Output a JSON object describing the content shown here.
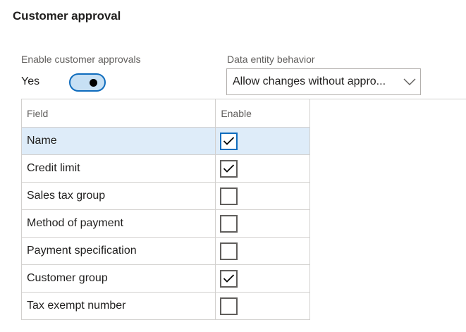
{
  "section": {
    "title": "Customer approval"
  },
  "enable_approvals": {
    "label": "Enable customer approvals",
    "value_text": "Yes",
    "on": true
  },
  "data_entity": {
    "label": "Data entity behavior",
    "selected": "Allow changes without appro..."
  },
  "grid": {
    "headers": {
      "field": "Field",
      "enable": "Enable"
    },
    "rows": [
      {
        "field": "Name",
        "enabled": true,
        "selected": true
      },
      {
        "field": "Credit limit",
        "enabled": true,
        "selected": false
      },
      {
        "field": "Sales tax group",
        "enabled": false,
        "selected": false
      },
      {
        "field": "Method of payment",
        "enabled": false,
        "selected": false
      },
      {
        "field": "Payment specification",
        "enabled": false,
        "selected": false
      },
      {
        "field": "Customer group",
        "enabled": true,
        "selected": false
      },
      {
        "field": "Tax exempt number",
        "enabled": false,
        "selected": false
      }
    ]
  },
  "colors": {
    "accent": "#0f6cbd",
    "selected_row": "#deecf9",
    "toggle_track": "#c7e0f4"
  },
  "icons": {
    "dropdown": "chevron-down-icon",
    "check": "checkmark-icon"
  }
}
